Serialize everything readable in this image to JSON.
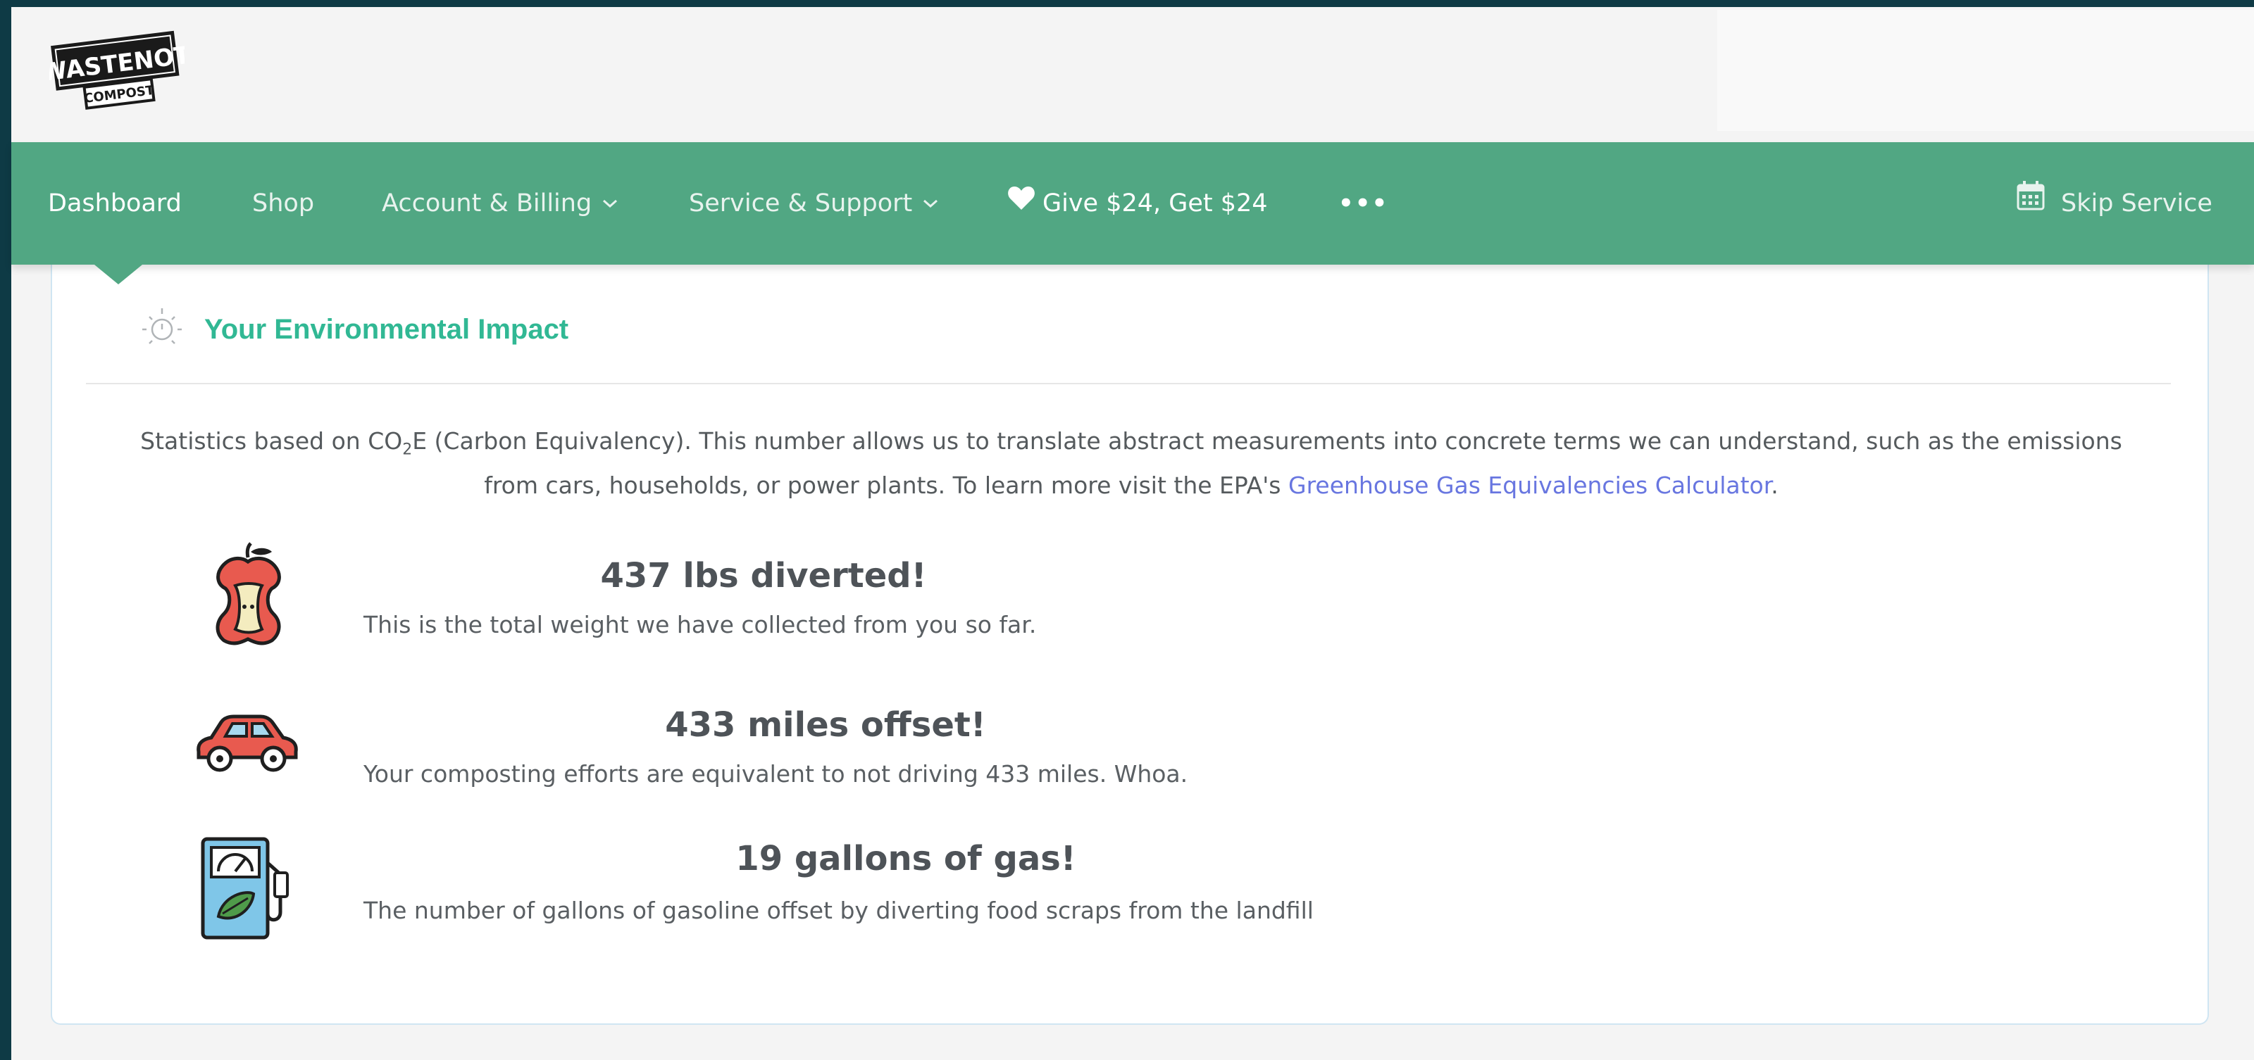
{
  "brand": {
    "logo_top": "WASTENOT",
    "logo_bottom": "COMPOST"
  },
  "nav": {
    "items": [
      {
        "label": "Dashboard"
      },
      {
        "label": "Shop"
      },
      {
        "label": "Account & Billing"
      },
      {
        "label": "Service & Support"
      },
      {
        "label": "Give $24, Get $24"
      },
      {
        "label": "•••"
      }
    ],
    "skip_label": "Skip Service"
  },
  "impact": {
    "title": "Your Environmental Impact",
    "intro_before": "Statistics based on CO",
    "intro_sub": "2",
    "intro_after": "E (Carbon Equivalency). This number allows us to translate abstract measurements into concrete terms we can understand, such as the emissions from cars, households, or power plants. To learn more visit the EPA's ",
    "link_label": "Greenhouse Gas Equivalencies Calculator",
    "intro_end": ".",
    "stats": [
      {
        "icon": "apple-core-icon",
        "title": "437 lbs diverted!",
        "desc": "This is the total weight we have collected from you so far."
      },
      {
        "icon": "car-icon",
        "title": "433 miles offset!",
        "desc": "Your composting efforts are equivalent to not driving 433 miles. Whoa."
      },
      {
        "icon": "gas-pump-icon",
        "title": "19 gallons of gas!",
        "desc": "The number of gallons of gasoline offset by diverting food scraps from the landfill"
      }
    ]
  },
  "colors": {
    "nav_green": "#51a783",
    "title_green": "#31b894",
    "link_blue": "#6876e0",
    "backdrop": "#0e3a45"
  }
}
